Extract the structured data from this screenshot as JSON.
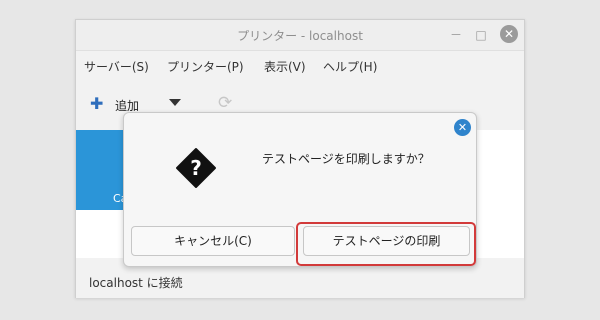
{
  "window": {
    "title": "プリンター - localhost",
    "controls": {
      "minimize": "－",
      "maximize": "□",
      "close": "✕"
    }
  },
  "menubar": {
    "items": [
      "サーバー(S)",
      "プリンター(P)",
      "表示(V)",
      "ヘルプ(H)"
    ]
  },
  "toolbar": {
    "add_label": "追加"
  },
  "content": {
    "printer_tile_text": "Ca"
  },
  "statusbar": {
    "text": "localhost に接続"
  },
  "dialog": {
    "message": "テストページを印刷しますか？",
    "cancel_label": "キャンセル(C)",
    "print_label": "テストページの印刷",
    "close_glyph": "✕"
  },
  "colors": {
    "accent_blue": "#2f84cc",
    "printer_tile": "#2b95d8",
    "highlight_red": "#d23a3a"
  },
  "icons": [
    "plus-icon",
    "chevron-down-icon",
    "reload-icon",
    "question-icon",
    "close-icon"
  ]
}
